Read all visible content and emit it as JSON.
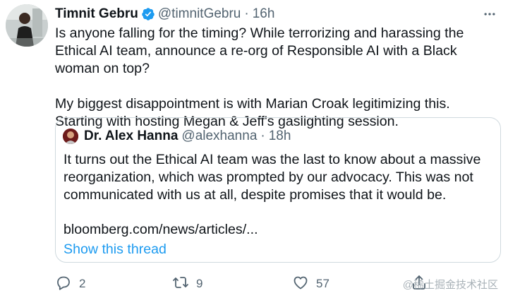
{
  "tweet": {
    "author_name": "Timnit Gebru",
    "handle": "@timnitGebru",
    "separator": "·",
    "time": "16h",
    "text": "Is anyone falling for the timing? While terrorizing and harassing the Ethical AI team, announce a re-org of Responsible AI with a Black woman on top?\n\nMy biggest disappointment is with Marian Croak legitimizing this. Starting with hosting Megan & Jeff's gaslighting session."
  },
  "quote": {
    "author_name": "Dr. Alex Hanna",
    "handle": "@alexhanna",
    "separator": "·",
    "time": "18h",
    "text": "It turns out the Ethical AI team was the last to know about a massive reorganization, which was prompted by our advocacy. This was not communicated with us at all, despite promises that it would be.",
    "link": "bloomberg.com/news/articles/...",
    "show_thread": "Show this thread"
  },
  "actions": {
    "replies": "2",
    "retweets": "9",
    "likes": "57"
  },
  "icons": {
    "verified": "verified-badge-icon",
    "more": "more-options-icon",
    "reply": "reply-icon",
    "retweet": "retweet-icon",
    "like": "heart-icon",
    "share": "share-icon"
  },
  "colors": {
    "accent": "#1d9bf0",
    "secondary_text": "#536471",
    "border": "#cfd9de"
  },
  "watermark": "@稀土掘金技术社区"
}
